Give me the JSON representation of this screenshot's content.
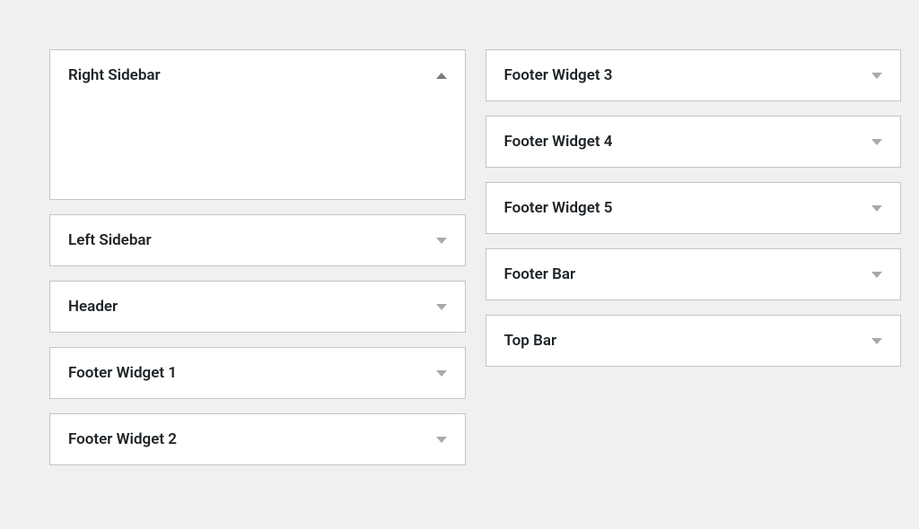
{
  "columns": {
    "left": [
      {
        "id": "right-sidebar",
        "title": "Right Sidebar",
        "expanded": true
      },
      {
        "id": "left-sidebar",
        "title": "Left Sidebar",
        "expanded": false
      },
      {
        "id": "header",
        "title": "Header",
        "expanded": false
      },
      {
        "id": "footer-widget-1",
        "title": "Footer Widget 1",
        "expanded": false
      },
      {
        "id": "footer-widget-2",
        "title": "Footer Widget 2",
        "expanded": false
      }
    ],
    "right": [
      {
        "id": "footer-widget-3",
        "title": "Footer Widget 3",
        "expanded": false
      },
      {
        "id": "footer-widget-4",
        "title": "Footer Widget 4",
        "expanded": false
      },
      {
        "id": "footer-widget-5",
        "title": "Footer Widget 5",
        "expanded": false
      },
      {
        "id": "footer-bar",
        "title": "Footer Bar",
        "expanded": false
      },
      {
        "id": "top-bar",
        "title": "Top Bar",
        "expanded": false
      }
    ]
  }
}
